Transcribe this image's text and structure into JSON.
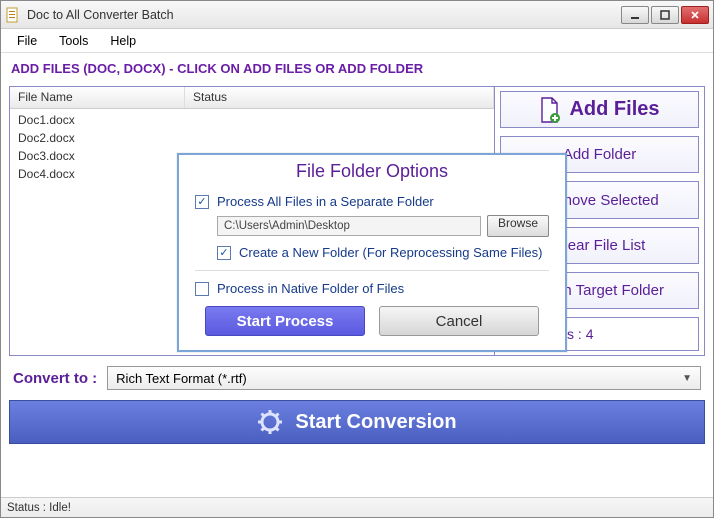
{
  "title": "Doc to All Converter Batch",
  "menu": {
    "file": "File",
    "tools": "Tools",
    "help": "Help"
  },
  "add_label": "ADD FILES (DOC, DOCX) - CLICK ON ADD FILES OR ADD FOLDER",
  "columns": {
    "name": "File Name",
    "status": "Status"
  },
  "files": [
    {
      "name": "Doc1.docx"
    },
    {
      "name": "Doc2.docx"
    },
    {
      "name": "Doc3.docx"
    },
    {
      "name": "Doc4.docx"
    }
  ],
  "side": {
    "add_files": "Add Files",
    "add_folder": "Add Folder",
    "remove_selected": "Remove Selected",
    "clear_list": "Clear File List",
    "open_target": "Open Target Folder"
  },
  "total_files": "Total Files : 4",
  "convert_label": "Convert to :",
  "convert_value": "Rich Text Format (*.rtf)",
  "start_conversion": "Start Conversion",
  "status": "Status :  Idle!",
  "dialog": {
    "title": "File Folder Options",
    "opt_separate": "Process All Files in a Separate Folder",
    "path": "C:\\Users\\Admin\\Desktop",
    "browse": "Browse",
    "opt_create_new": "Create a New Folder (For Reprocessing Same Files)",
    "opt_native": "Process in Native Folder of Files",
    "start": "Start Process",
    "cancel": "Cancel"
  }
}
